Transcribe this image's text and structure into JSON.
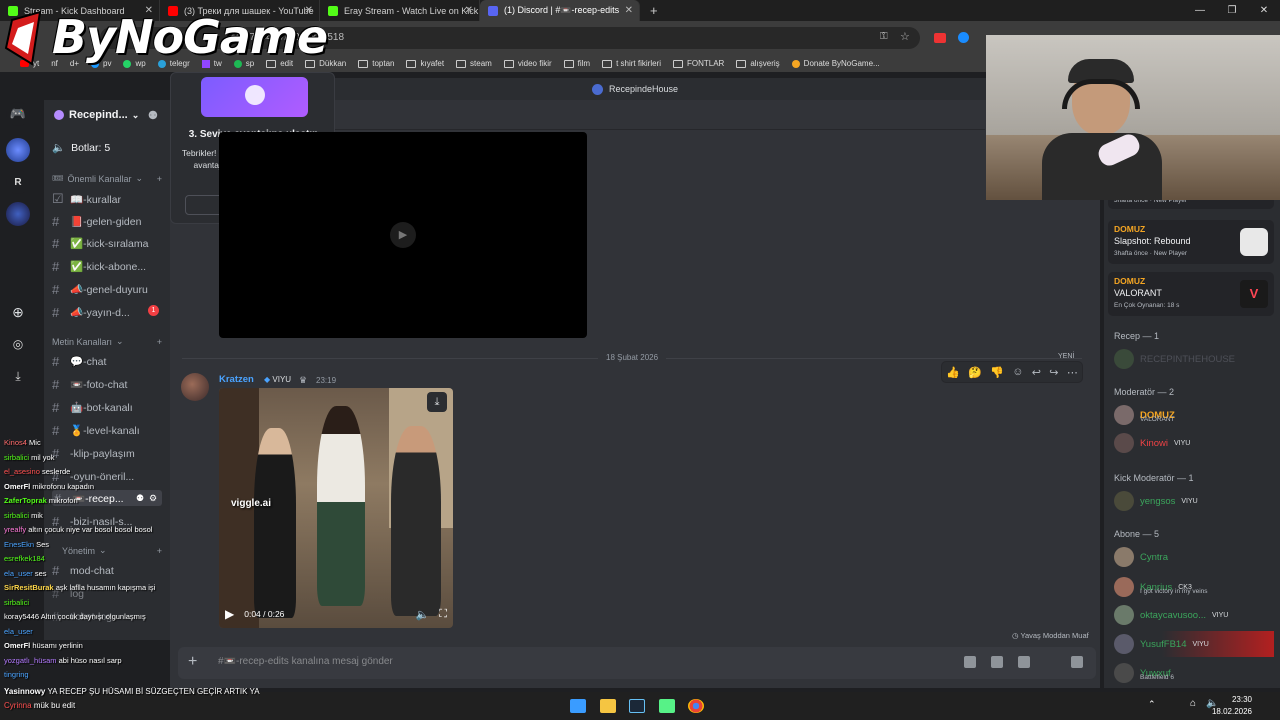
{
  "browser": {
    "tabs": [
      {
        "label": "Stream - Kick Dashboard",
        "color": "#53fc18"
      },
      {
        "label": "(3) Треки для шашек - YouTube",
        "color": "#ff0000"
      },
      {
        "label": "Eray Stream - Watch Live on Kick",
        "color": "#53fc18"
      },
      {
        "label": "(1) Discord | #📼-recep-edits",
        "color": "#5865f2",
        "active": true
      }
    ],
    "new_tab": "+",
    "url": "4/1470441079017832518",
    "bookmarks": [
      "yt",
      "nf",
      "d+",
      "pv",
      "wp",
      "telegr",
      "tw",
      "sp",
      "edit",
      "Dükkan",
      "toptan",
      "kıyafet",
      "steam",
      "video fikir",
      "film",
      "t shirt fikirleri",
      "FONTLAR",
      "alışveriş",
      "Donate ByNoGame..."
    ]
  },
  "logo": {
    "text": "ByNoGame"
  },
  "discord": {
    "server_name": "Recepind...",
    "bots_label": "Botlar: 5",
    "categories": {
      "important": "Önemli Kanallar",
      "text": "Metin Kanalları",
      "admin": "Yönetim"
    },
    "channels_important": [
      "📖-kurallar",
      "📕-gelen-giden",
      "✅-kick-sıralama",
      "✅-kick-abone...",
      "📣-genel-duyuru",
      "📣-yayın-d..."
    ],
    "channels_text": [
      "💬-chat",
      "📼-foto-chat",
      "🤖-bot-kanalı",
      "🏅-level-kanalı",
      "-klip-paylaşım",
      "-oyun-öneril...",
      "📼-recep...",
      "-bizi-nasıl-s..."
    ],
    "channels_admin": [
      "mod-chat",
      "log",
      "ticket-log"
    ],
    "unread_badge": "1",
    "chat_topbar": "RecepindeHouse",
    "popup": {
      "title": "3. Seviye avantajına ulaştın",
      "body": "Tebrikler! Sunucun artık tüm 3. Seviye avantajlarına tam erişime sahip.",
      "button": "Bir göz at"
    },
    "date_divider": "18 Şubat 2026",
    "new_tag": "YENİ",
    "message": {
      "author": "Kratzen",
      "tag": "VIYU",
      "time": "23:19",
      "video_time": "0:04 / 0:26",
      "watermark": "viggle.ai"
    },
    "slowmode": "Yavaş Moddan Muaf",
    "composer_placeholder": "#📼-recep-edits kanalına mesaj gönder",
    "activities": [
      {
        "name": "DOMUZ",
        "game": "",
        "sub": "3hafta önce · New Player"
      },
      {
        "name": "DOMUZ",
        "game": "Slapshot: Rebound",
        "sub": "3hafta önce · New Player"
      },
      {
        "name": "DOMUZ",
        "game": "VALORANT",
        "sub": "En Çok Oynanan: 18 s"
      }
    ],
    "member_groups": [
      {
        "title": "Recep — 1",
        "members": [
          {
            "name": "RECEPINTHEHOUSE",
            "color": "#4e5058",
            "sub": ""
          }
        ]
      },
      {
        "title": "Moderatör — 2",
        "members": [
          {
            "name": "DOMUZ",
            "color": "#f5a623",
            "sub": "VALORANT"
          },
          {
            "name": "Kinowi",
            "color": "#ed4245",
            "tag": "VIYU"
          }
        ]
      },
      {
        "title": "Kick Moderatör — 1",
        "members": [
          {
            "name": "yengsos",
            "color": "#3ba55c",
            "tag": "VIYU"
          }
        ]
      },
      {
        "title": "Abone — 5",
        "members": [
          {
            "name": "Cyntra",
            "color": "#3ba55c"
          },
          {
            "name": "Kanrius",
            "color": "#3ba55c",
            "tag": "CK3",
            "sub": "I got victory in my veins"
          },
          {
            "name": "oktaycavusoo...",
            "color": "#3ba55c",
            "tag": "VIYU"
          },
          {
            "name": "YusufFB14",
            "color": "#3ba55c",
            "tag": "VIYU"
          },
          {
            "name": "Yuwxuf",
            "color": "#3ba55c",
            "sub": "Battlefield 6"
          }
        ]
      }
    ]
  },
  "kick_chat": [
    {
      "user": "Kinos4",
      "color": "#ff6b6b",
      "text": "Mic"
    },
    {
      "user": "sirbalici",
      "color": "#53fc18",
      "text": "mil yok"
    },
    {
      "user": "el_asesino",
      "color": "#ff5050",
      "text": "seslerde"
    },
    {
      "user": "OmerFl",
      "color": "#ffffff",
      "text": "mikrofonu kapadın"
    },
    {
      "user": "ZaferToprak",
      "color": "#53fc18",
      "text": "mikrofon"
    },
    {
      "user": "sirbalici",
      "color": "#53fc18",
      "text": "mik"
    },
    {
      "user": "yrealfy",
      "color": "#ff7ad9",
      "text": "altın çocuk niye var bosol bosol bosol"
    },
    {
      "user": "EnesEkn",
      "color": "#4aa3ff",
      "text": "Ses"
    },
    {
      "user": "esrefkek184",
      "color": "#53fc18",
      "text": ""
    },
    {
      "user": "ela_user",
      "color": "#4aa3ff",
      "text": "ses"
    },
    {
      "user": "SirResitBurak",
      "color": "#ffd84a",
      "text": "aşk laflla husamın kapışma işi"
    },
    {
      "user": "sirbalici",
      "color": "#53fc18",
      "text": ""
    },
    {
      "user": "koray5446",
      "color": "#ffffff",
      "text": "Altın çocuk daynışı olgunlaşmış"
    },
    {
      "user": "ela_user",
      "color": "#4aa3ff",
      "text": ""
    },
    {
      "user": "OmerFl",
      "color": "#ffffff",
      "text": "hüsamı yerlinin"
    },
    {
      "user": "yozgatlı_hüsam",
      "color": "#b47aff",
      "text": "abi hüso nasıl sarp"
    },
    {
      "user": "tingring",
      "color": "#4aa3ff",
      "text": ""
    }
  ],
  "bottom_chat": [
    {
      "user": "Yasinnowy",
      "color": "#ffffff",
      "text": "YA RECEP ŞU HÜSAMI Bİ SÜZGEÇTEN GEÇİR ARTIK YA"
    },
    {
      "user": "Cyrinna",
      "color": "#ff5050",
      "text": "mük bu edit"
    }
  ],
  "taskbar": {
    "time": "23:30",
    "date": "18.02.2026"
  }
}
